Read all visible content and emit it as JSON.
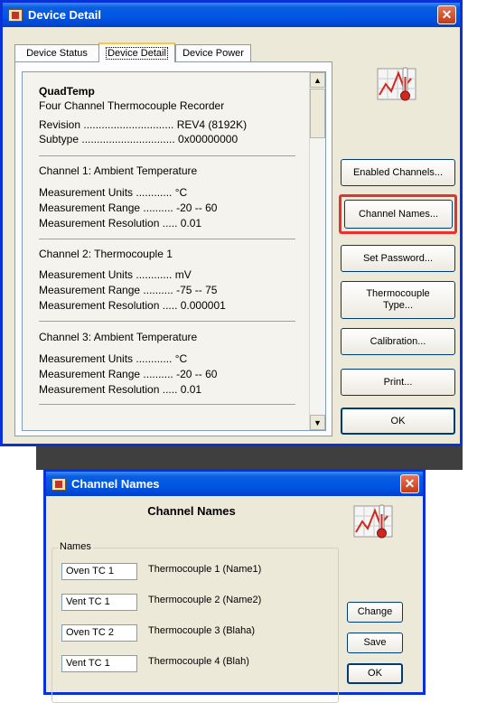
{
  "device_detail": {
    "title": "Device Detail",
    "tabs": [
      "Device Status",
      "Device Detail",
      "Device Power"
    ],
    "device_name": "QuadTemp",
    "device_desc": "Four Channel Thermocouple Recorder",
    "revision_row": "Revision .............................. REV4 (8192K)",
    "subtype_row": "Subtype ............................... 0x00000000",
    "channels": [
      {
        "header": "Channel 1: Ambient Temperature",
        "units": "Measurement Units ............ °C",
        "range": "Measurement Range .......... -20 -- 60",
        "resolution": "Measurement Resolution ..... 0.01"
      },
      {
        "header": "Channel 2: Thermocouple  1",
        "units": "Measurement Units ............ mV",
        "range": "Measurement Range .......... -75 -- 75",
        "resolution": "Measurement Resolution ..... 0.000001"
      },
      {
        "header": "Channel 3: Ambient Temperature",
        "units": "Measurement Units ............ °C",
        "range": "Measurement Range .......... -20 -- 60",
        "resolution": "Measurement Resolution ..... 0.01"
      }
    ],
    "buttons": {
      "enabled_channels": "Enabled Channels...",
      "channel_names": "Channel Names...",
      "set_password": "Set Password...",
      "thermocouple_type": "Thermocouple Type...",
      "calibration": "Calibration...",
      "print": "Print...",
      "ok": "OK"
    },
    "close_glyph": "✕",
    "highlight_color": "#e83030"
  },
  "channel_names": {
    "title": "Channel Names",
    "heading": "Channel Names",
    "group_label": "Names",
    "rows": [
      {
        "value": "Oven TC 1",
        "label": "Thermocouple  1 (Name1)"
      },
      {
        "value": "Vent TC 1",
        "label": "Thermocouple  2 (Name2)"
      },
      {
        "value": "Oven TC 2",
        "label": "Thermocouple  3 (Blaha)"
      },
      {
        "value": "Vent TC 1",
        "label": "Thermocouple  4 (Blah)"
      }
    ],
    "buttons": {
      "change": "Change",
      "save": "Save",
      "ok": "OK"
    },
    "close_glyph": "✕"
  }
}
